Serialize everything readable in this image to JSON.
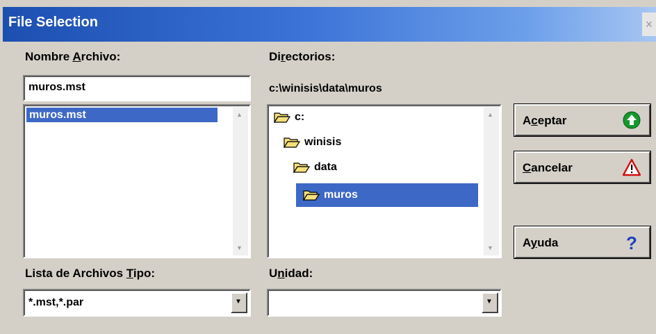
{
  "window": {
    "title": "File Selection",
    "close_glyph": "×"
  },
  "file_name": {
    "label_before": "Nombre ",
    "label_accel": "A",
    "label_after": "rchivo:",
    "value": "muros.mst",
    "list_items": [
      "muros.mst"
    ],
    "selected_index": 0
  },
  "directories": {
    "label_before": "Di",
    "label_accel": "r",
    "label_after": "ectorios:",
    "current_path": "c:\\winisis\\data\\muros",
    "tree": [
      {
        "name": "c:",
        "depth": 0,
        "selected": false
      },
      {
        "name": "winisis",
        "depth": 1,
        "selected": false
      },
      {
        "name": "data",
        "depth": 2,
        "selected": false
      },
      {
        "name": "muros",
        "depth": 3,
        "selected": true
      }
    ]
  },
  "file_type": {
    "label_before": "Lista de Archivos ",
    "label_accel": "T",
    "label_after": "ipo:",
    "value": "*.mst,*.par"
  },
  "drive": {
    "label_before": "U",
    "label_accel": "n",
    "label_after": "idad:",
    "value": ""
  },
  "buttons": {
    "accept": {
      "before": "A",
      "accel": "c",
      "after": "eptar",
      "icon": "green-up-arrow-icon"
    },
    "cancel": {
      "before": "",
      "accel": "C",
      "after": "ancelar",
      "icon": "warning-triangle-icon"
    },
    "help": {
      "before": "A",
      "accel": "y",
      "after": "uda",
      "icon": "question-mark-icon"
    }
  },
  "colors": {
    "selection": "#3d68c6",
    "title_gradient_start": "#1c4fb0",
    "dialog_face": "#d4d0c8"
  }
}
